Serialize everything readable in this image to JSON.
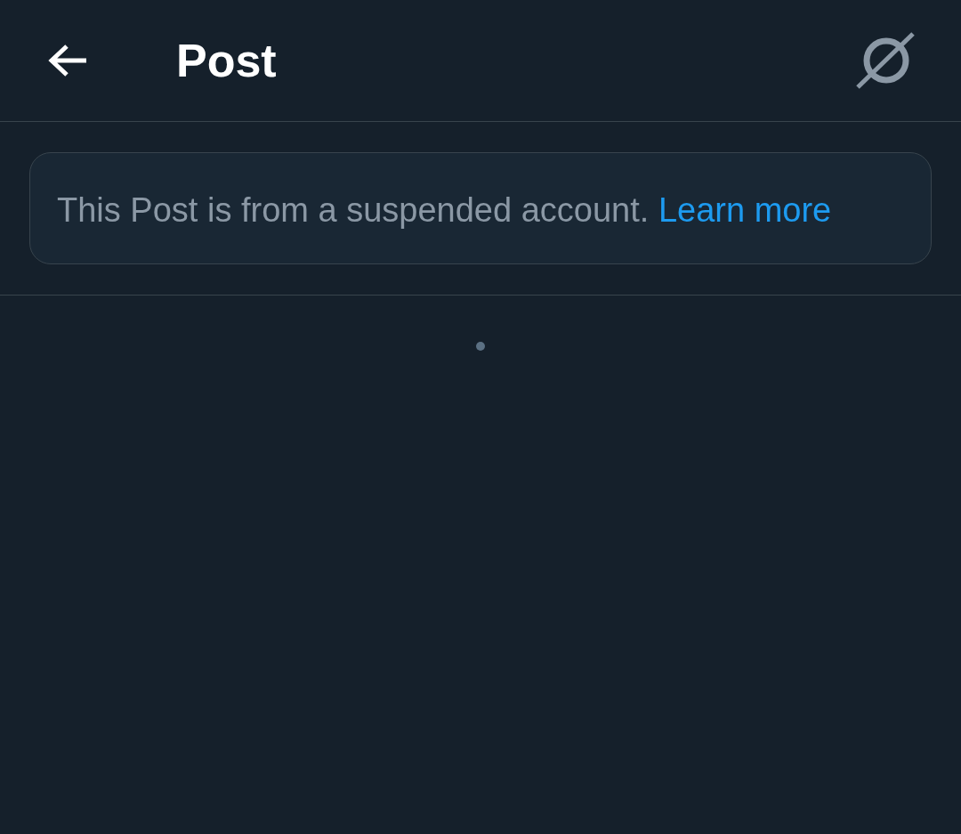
{
  "header": {
    "title": "Post"
  },
  "notice": {
    "text": "This Post is from a suspended account.",
    "link": "Learn more"
  }
}
